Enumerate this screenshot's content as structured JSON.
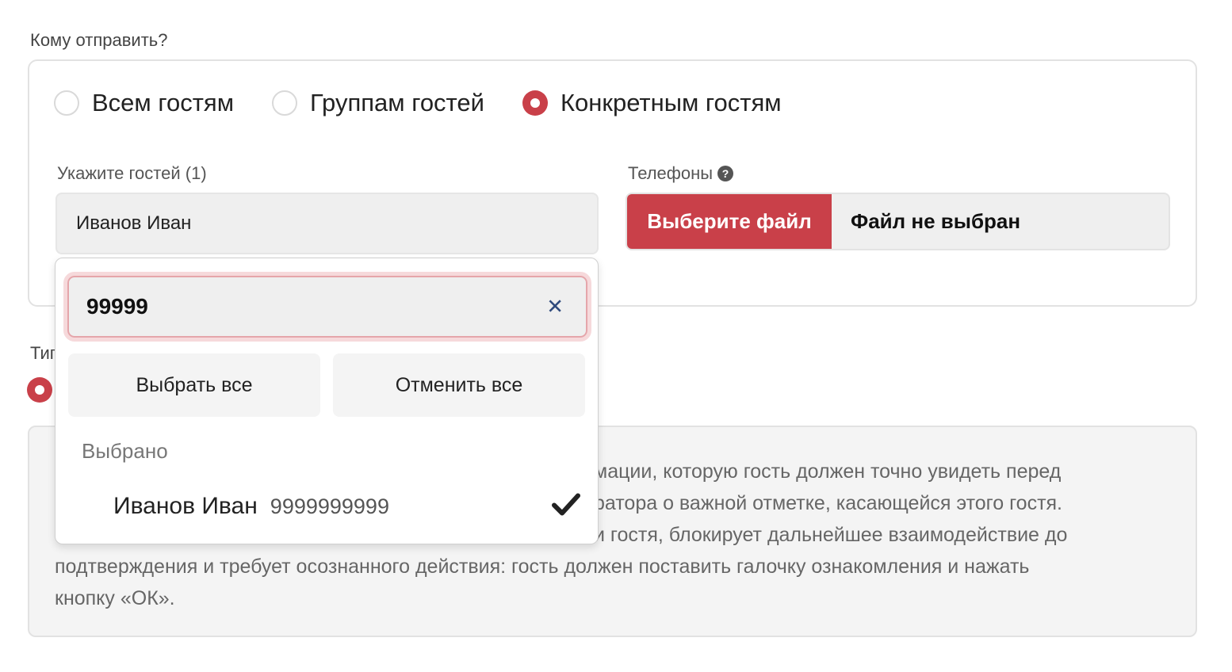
{
  "recipients": {
    "label": "Кому отправить?",
    "options": [
      {
        "label": "Всем гостям",
        "selected": false
      },
      {
        "label": "Группам гостей",
        "selected": false
      },
      {
        "label": "Конкретным гостям",
        "selected": true
      }
    ]
  },
  "guests_field": {
    "label": "Укажите гостей (1)",
    "value": "Иванов Иван"
  },
  "phones_field": {
    "label": "Телефоны",
    "help_icon": "?",
    "button_label": "Выберите файл",
    "status": "Файл не выбран"
  },
  "dropdown": {
    "search_value": "99999",
    "clear_icon": "✕",
    "select_all_label": "Выбрать все",
    "deselect_all_label": "Отменить все",
    "group_label": "Выбрано",
    "options": [
      {
        "name": "Иванов Иван",
        "phone": "9999999999",
        "selected": true
      }
    ]
  },
  "type_section": {
    "label": "Тип"
  },
  "info": {
    "text_lines": [
      "мации, которую гость должен точно увидеть перед",
      "ратора о важной отметке, касающейся этого гостя.",
      "и гостя, блокирует дальнейшее взаимодействие до",
      "подтверждения и требует осознанного действия: гость должен поставить галочку ознакомления и нажать",
      "кнопку «ОК»."
    ]
  },
  "colors": {
    "accent": "#c94049",
    "clear_icon": "#2f4a7d"
  }
}
